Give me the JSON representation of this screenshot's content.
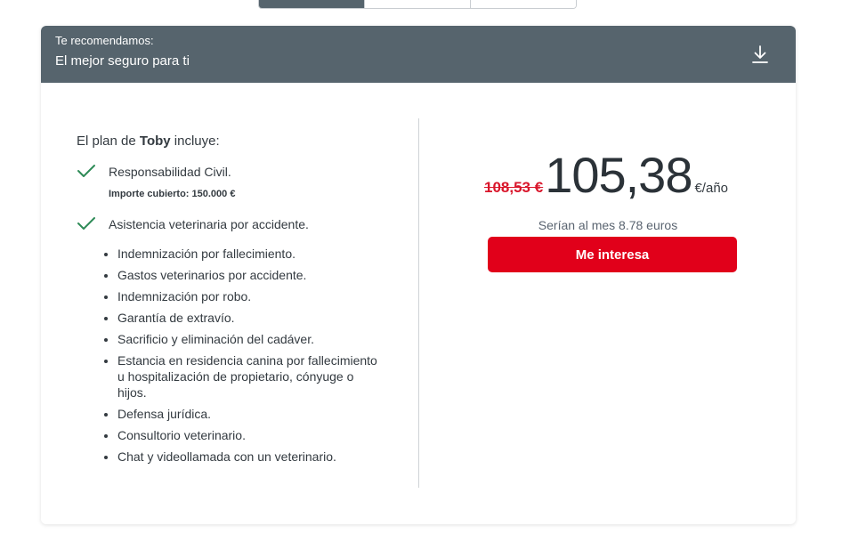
{
  "header": {
    "label": "Te recomendamos:",
    "title": "El mejor seguro para ti"
  },
  "plan": {
    "heading_prefix": "El plan de ",
    "pet_name": "Toby",
    "heading_suffix": " incluye:",
    "features": [
      {
        "title": "Responsabilidad Civil.",
        "coverage": "Importe cubierto: 150.000 €"
      },
      {
        "title": "Asistencia veterinaria por accidente."
      }
    ],
    "sub_items": [
      "Indemnización por fallecimiento.",
      "Gastos veterinarios por accidente.",
      "Indemnización por robo.",
      "Garantía de extravío.",
      "Sacrificio y eliminación del cadáver.",
      "Estancia en residencia canina por fallecimiento u hospitalización de propietario, cónyuge o hijos.",
      "Defensa jurídica.",
      "Consultorio veterinario.",
      "Chat y videollamada con un veterinario."
    ]
  },
  "pricing": {
    "old_price": "108,53 €",
    "price": "105,38",
    "unit": "€/año",
    "monthly": "Serían al mes 8.78 euros",
    "cta_label": "Me interesa"
  },
  "colors": {
    "header_bg": "#56646d",
    "cta_bg": "#e1001a",
    "old_price": "#d9162b",
    "check": "#2e8b57"
  },
  "icons": {
    "download": "download-icon",
    "check": "checkmark-icon"
  }
}
